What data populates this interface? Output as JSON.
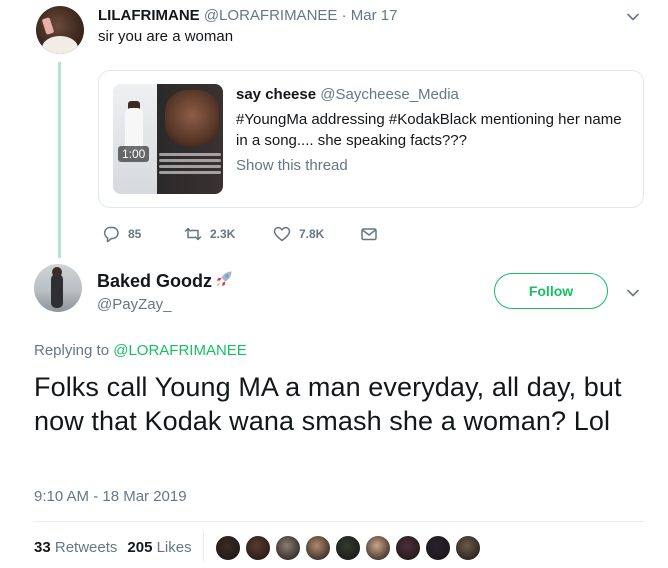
{
  "parent_tweet": {
    "name": "LILAFRIMANE",
    "handle": "@LORAFRIMANEE",
    "separator": "·",
    "date": "Mar 17",
    "text": "sir you are a woman",
    "quote": {
      "name": "say cheese",
      "handle": "@Saycheese_Media",
      "text": "#YoungMa addressing #KodakBlack mentioning her name in a song.... she speaking facts???",
      "show_thread": "Show this thread",
      "video_duration": "1:00"
    },
    "actions": {
      "replies": "85",
      "retweets": "2.3K",
      "likes": "7.8K"
    }
  },
  "main_tweet": {
    "name": "Baked Goodz",
    "handle": "@PayZay_",
    "follow_label": "Follow",
    "replying_prefix": "Replying to",
    "replying_to": "@LORAFRIMANEE",
    "text": "Folks call Young MA a man everyday, all day, but now that Kodak wana smash she a woman? Lol",
    "timestamp": "9:10 AM - 18 Mar 2019",
    "stats": {
      "retweets_count": "33",
      "retweets_label": "Retweets",
      "likes_count": "205",
      "likes_label": "Likes"
    },
    "liker_avatar_colors": [
      "#3a2c26",
      "#5a3a2e",
      "#8a7d72",
      "#b08a6e",
      "#2f3b2f",
      "#c9a48a",
      "#4a2f3a",
      "#2a2230",
      "#6b5a48"
    ]
  },
  "colors": {
    "accent": "#17bf63",
    "thread_line": "#b3e6cc",
    "secondary_text": "#657786",
    "primary_text": "#14171a"
  },
  "icons": {
    "caret": "chevron-down-icon",
    "reply": "reply-bubble-icon",
    "retweet": "retweet-icon",
    "like": "heart-icon",
    "message": "envelope-icon",
    "emoji": "rocket-emoji"
  }
}
